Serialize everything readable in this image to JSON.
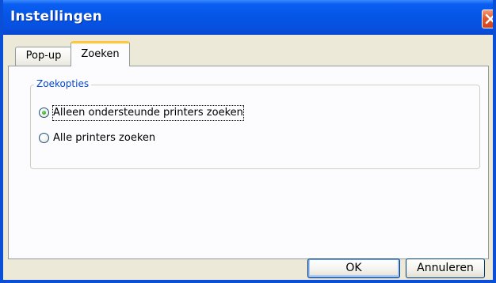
{
  "window": {
    "title": "Instellingen"
  },
  "titlebar": {
    "close_icon": "close-icon"
  },
  "tabs": [
    {
      "label": "Pop-up",
      "active": false
    },
    {
      "label": "Zoeken",
      "active": true
    }
  ],
  "search_options": {
    "group_label": "Zoekopties",
    "options": [
      {
        "label": "Alleen ondersteunde printers zoeken",
        "selected": true
      },
      {
        "label": "Alle printers zoeken",
        "selected": false
      }
    ]
  },
  "buttons": {
    "ok_label": "OK",
    "cancel_label": "Annuleren"
  },
  "colors": {
    "titlebar": "#0556e6",
    "close_button": "#e4592e",
    "active_tab_accent": "#ffc83c",
    "group_label": "#0046d5",
    "dialog_background": "#ece9d8"
  }
}
